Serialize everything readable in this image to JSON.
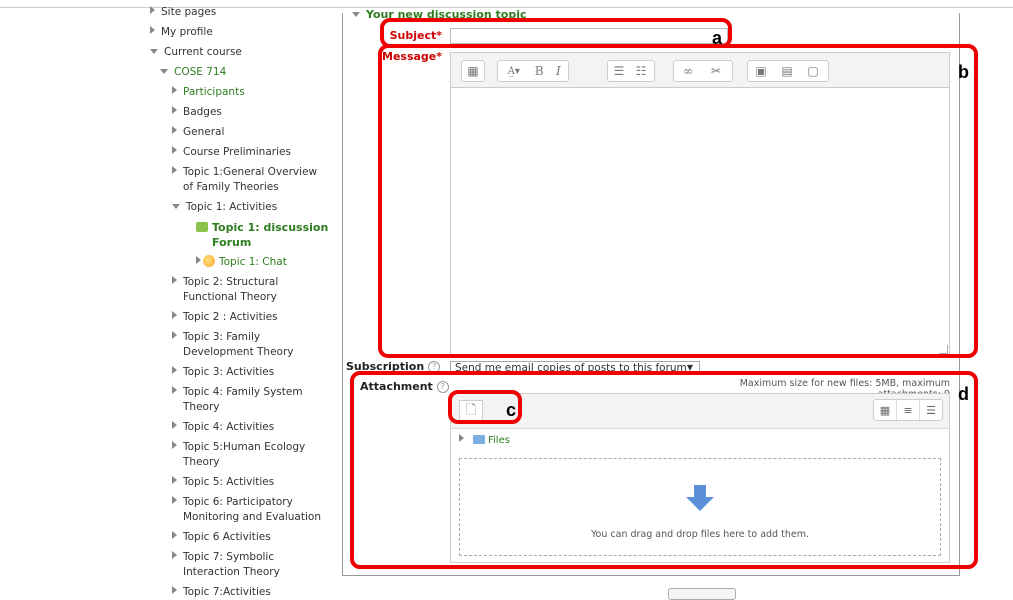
{
  "nav": {
    "items": [
      {
        "label": "Site pages",
        "indent": 0,
        "arrow": "right",
        "style": ""
      },
      {
        "label": "My profile",
        "indent": 0,
        "arrow": "right",
        "style": ""
      },
      {
        "label": "Current course",
        "indent": 0,
        "arrow": "down",
        "style": ""
      },
      {
        "label": "COSE 714",
        "indent": 1,
        "arrow": "down",
        "style": "green"
      },
      {
        "label": "Participants",
        "indent": 2,
        "arrow": "right",
        "style": "green"
      },
      {
        "label": "Badges",
        "indent": 2,
        "arrow": "right",
        "style": ""
      },
      {
        "label": "General",
        "indent": 2,
        "arrow": "right",
        "style": ""
      },
      {
        "label": "Course Preliminaries",
        "indent": 2,
        "arrow": "right",
        "style": ""
      },
      {
        "label": "Topic 1:General Overview",
        "label2": "of Family Theories",
        "indent": 2,
        "arrow": "right",
        "style": ""
      },
      {
        "label": "Topic 1: Activities",
        "indent": 2,
        "arrow": "down",
        "style": ""
      },
      {
        "label": "Topic 1: discussion",
        "label2": "Forum",
        "indent": 3,
        "arrow": "forum",
        "style": "green bold"
      },
      {
        "label": "Topic 1: Chat",
        "indent": 3,
        "arrow": "chat",
        "style": "green"
      },
      {
        "label": "Topic 2: Structural",
        "label2": "Functional Theory",
        "indent": 2,
        "arrow": "right",
        "style": ""
      },
      {
        "label": "Topic 2 : Activities",
        "indent": 2,
        "arrow": "right",
        "style": ""
      },
      {
        "label": "Topic 3: Family",
        "label2": "Development Theory",
        "indent": 2,
        "arrow": "right",
        "style": ""
      },
      {
        "label": "Topic 3: Activities",
        "indent": 2,
        "arrow": "right",
        "style": ""
      },
      {
        "label": "Topic 4: Family System",
        "label2": "Theory",
        "indent": 2,
        "arrow": "right",
        "style": ""
      },
      {
        "label": "Topic 4: Activities",
        "indent": 2,
        "arrow": "right",
        "style": ""
      },
      {
        "label": "Topic 5:Human Ecology",
        "label2": "Theory",
        "indent": 2,
        "arrow": "right",
        "style": ""
      },
      {
        "label": "Topic 5: Activities",
        "indent": 2,
        "arrow": "right",
        "style": ""
      },
      {
        "label": "Topic 6: Participatory",
        "label2": "Monitoring and Evaluation",
        "indent": 2,
        "arrow": "right",
        "style": ""
      },
      {
        "label": "Topic 6 Activities",
        "indent": 2,
        "arrow": "right",
        "style": ""
      },
      {
        "label": "Topic 7: Symbolic",
        "label2": "Interaction Theory",
        "indent": 2,
        "arrow": "right",
        "style": ""
      },
      {
        "label": "Topic 7:Activities",
        "indent": 2,
        "arrow": "right",
        "style": ""
      }
    ]
  },
  "form": {
    "legend": "Your new discussion topic",
    "subject_label": "Subject",
    "required_mark": "*",
    "subject_value": "",
    "message_label": "Message",
    "message_value": "",
    "subscription_label": "Subscription",
    "subscription_value": "Send me email copies of posts to this forum",
    "attachment_label": "Attachment",
    "max_info": "Maximum size for new files: 5MB, maximum attachments: 9",
    "files_label": "Files",
    "drop_text": "You can drag and drop files here to add them."
  },
  "toolbar": {
    "icons": [
      "collapse-icon",
      "font-color-icon",
      "bold-icon",
      "italic-icon",
      "unordered-list-icon",
      "ordered-list-icon",
      "link-icon",
      "unlink-icon",
      "image-icon",
      "media-icon",
      "file-icon"
    ],
    "bold_glyph": "B",
    "italic_glyph": "I"
  },
  "annotations": {
    "a": "a",
    "b": "b",
    "c": "c",
    "d": "d"
  },
  "colors": {
    "highlight": "#e00000",
    "link_green": "#2e7d1f",
    "required_red": "#cc0000"
  }
}
